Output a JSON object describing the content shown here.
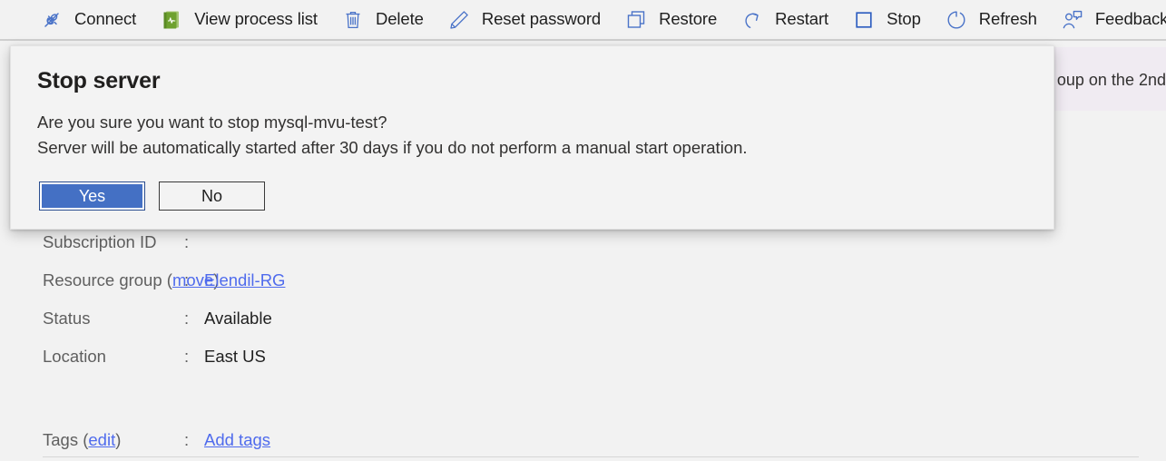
{
  "toolbar": {
    "items": [
      {
        "label": "Connect",
        "icon": "connect-plug-icon"
      },
      {
        "label": "View process list",
        "icon": "process-list-book-icon"
      },
      {
        "label": "Delete",
        "icon": "trash-icon"
      },
      {
        "label": "Reset password",
        "icon": "pencil-icon"
      },
      {
        "label": "Restore",
        "icon": "copy-restore-icon"
      },
      {
        "label": "Restart",
        "icon": "restart-arrow-icon"
      },
      {
        "label": "Stop",
        "icon": "stop-square-icon"
      },
      {
        "label": "Refresh",
        "icon": "refresh-circle-icon"
      },
      {
        "label": "Feedback",
        "icon": "feedback-person-icon"
      }
    ]
  },
  "banner": {
    "text": "oup on the 2nd"
  },
  "dialog": {
    "title": "Stop server",
    "line1": "Are you sure you want to stop mysql-mvu-test?",
    "line2": "Server will be automatically started after 30 days if you do not perform a manual start operation.",
    "yes_label": "Yes",
    "no_label": "No"
  },
  "properties": [
    {
      "key": "Subscription ID",
      "value": ""
    },
    {
      "key": "Resource group (move)",
      "value": "Elendil-RG",
      "link": true,
      "key_link": "move"
    },
    {
      "key": "Status",
      "value": "Available"
    },
    {
      "key": "Location",
      "value": "East US"
    },
    {
      "key": "Tags (edit)",
      "value": "Add tags",
      "link": true,
      "key_link": "edit"
    }
  ],
  "colors": {
    "accent_blue": "#4470c4",
    "link_blue": "#4f6bed",
    "icon_blue": "#4a73c8",
    "icon_green": "#76a73f",
    "banner_bg": "#f0ebf2",
    "page_bg": "#f2f2f2"
  }
}
